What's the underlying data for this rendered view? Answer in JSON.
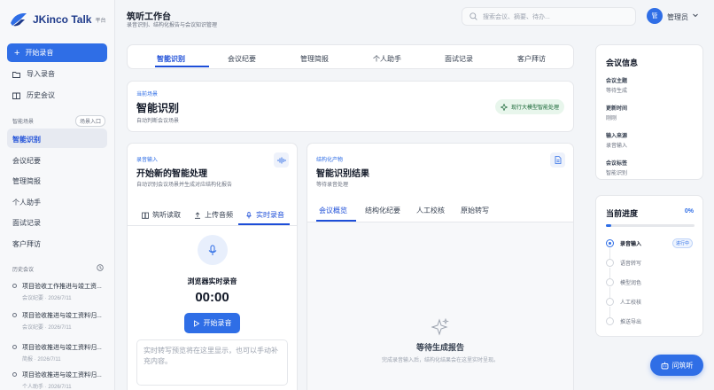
{
  "brand": {
    "name": "JKinco Talk",
    "tag": "平台"
  },
  "header": {
    "title": "筑听工作台",
    "subtitle": "录音识别、结构化报告与会议知识管理"
  },
  "search": {
    "placeholder": "搜索会议、摘要、待办..."
  },
  "user": {
    "avatar_text": "管",
    "name": "管理员"
  },
  "sidebar": {
    "start_label": "开始录音",
    "import_label": "导入录音",
    "history_label": "历史会议",
    "scene_section": "智能场景",
    "scene_entry": "场景入口",
    "scenes": [
      "智能识别",
      "会议纪要",
      "管理简报",
      "个人助手",
      "面试记录",
      "客户拜访"
    ],
    "history_section": "历史会议",
    "history": [
      {
        "title": "项目验收工作推进与竣工资...",
        "meta": "会议纪要 · 2026/7/11"
      },
      {
        "title": "项目验收推进与竣工资料归...",
        "meta": "会议纪要 · 2026/7/11"
      },
      {
        "title": "项目验收推进与竣工资料归...",
        "meta": "简报 · 2026/7/11"
      },
      {
        "title": "项目验收推进与竣工资料归...",
        "meta": "个人助手 · 2026/7/11"
      }
    ]
  },
  "top_tabs": [
    "智能识别",
    "会议纪要",
    "管理简报",
    "个人助手",
    "面试记录",
    "客户拜访"
  ],
  "scene_card": {
    "label": "当前场景",
    "title": "智能识别",
    "desc": "自动判断会议场景",
    "pill": "现行大模型智能处理"
  },
  "input_card": {
    "label": "录音输入",
    "title": "开始新的智能处理",
    "desc": "自动识别会议场景并生成对应结构化报告",
    "modes": [
      "筑听读取",
      "上传音频",
      "实时录音"
    ],
    "rec_title": "浏览器实时录音",
    "timer": "00:00",
    "rec_button": "开始录音",
    "textarea_placeholder": "实时转写预览将在这里显示，也可以手动补充内容。"
  },
  "result_card": {
    "label": "结构化产物",
    "title": "智能识别结果",
    "desc": "等待录音处理",
    "tabs": [
      "会议概览",
      "结构化纪要",
      "人工校核",
      "原始转写"
    ],
    "wait_title": "等待生成报告",
    "wait_sub": "完成录音输入后，结构化结果会在这里实时呈现。"
  },
  "info": {
    "title": "会议信息",
    "rows": [
      {
        "k": "会议主题",
        "v": "等待生成"
      },
      {
        "k": "更新时间",
        "v": "刚刚"
      },
      {
        "k": "输入来源",
        "v": "录音输入"
      },
      {
        "k": "会议标签",
        "v": "智能识别"
      }
    ]
  },
  "progress": {
    "title": "当前进度",
    "percent_text": "0%",
    "percent": 0.06,
    "badge": "进行中",
    "steps": [
      "录音输入",
      "语音转写",
      "模型润色",
      "人工校核",
      "推送导出"
    ]
  },
  "float_button": "问筑听",
  "colors": {
    "accent": "#2f6ee6",
    "pill_bg": "#e8f6ec"
  }
}
